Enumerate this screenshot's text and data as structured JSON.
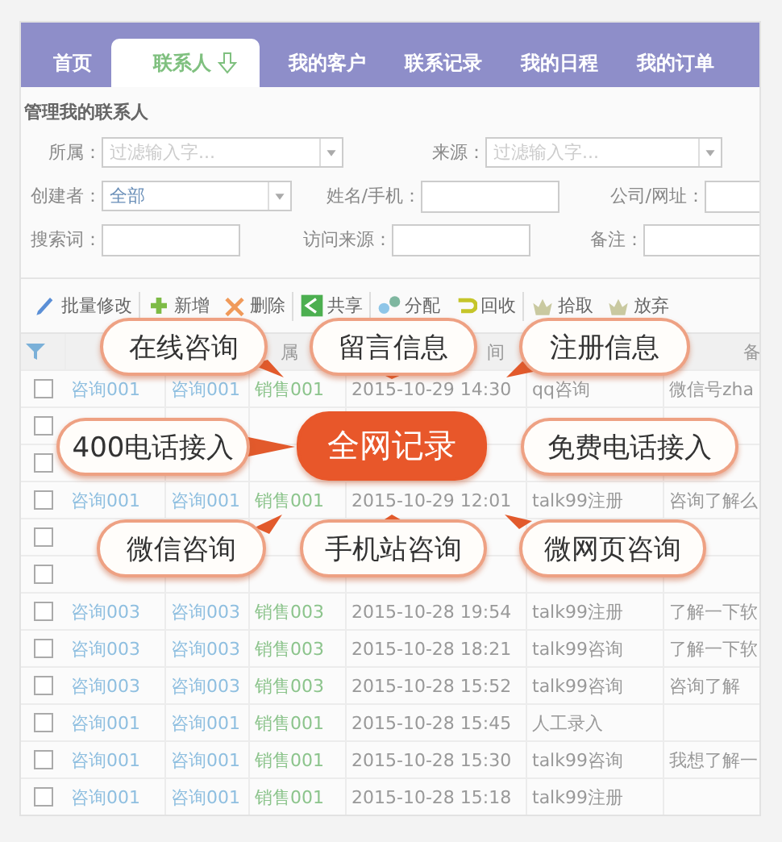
{
  "nav": {
    "tabs": [
      {
        "label": "首页",
        "selected": false
      },
      {
        "label": "联系人",
        "selected": true
      },
      {
        "label": "我的客户",
        "selected": false
      },
      {
        "label": "联系记录",
        "selected": false
      },
      {
        "label": "我的日程",
        "selected": false
      },
      {
        "label": "我的订单",
        "selected": false
      }
    ]
  },
  "heading": "管理我的联系人",
  "filters": [
    [
      {
        "label": "所属：",
        "kind": "select",
        "placeholder": "过滤输入字..."
      },
      {
        "label": "来源：",
        "kind": "select",
        "placeholder": "过滤输入字..."
      }
    ],
    [
      {
        "label": "创建者：",
        "kind": "select",
        "value": "全部"
      },
      {
        "label": "姓名/手机：",
        "kind": "input"
      },
      {
        "label": "公司/网址：",
        "kind": "input"
      }
    ],
    [
      {
        "label": "搜索词：",
        "kind": "input"
      },
      {
        "label": "访问来源：",
        "kind": "input"
      },
      {
        "label": "备注：",
        "kind": "input"
      }
    ]
  ],
  "toolbar": [
    {
      "label": "批量修改",
      "kind": "edit"
    },
    {
      "label": "新增",
      "kind": "add"
    },
    {
      "label": "删除",
      "kind": "delete"
    },
    {
      "label": "共享",
      "kind": "share"
    },
    {
      "label": "分配",
      "kind": "assign"
    },
    {
      "label": "回收",
      "kind": "recycle"
    },
    {
      "label": "拾取",
      "kind": "pick"
    },
    {
      "label": "放弃",
      "kind": "drop"
    }
  ],
  "table": {
    "columns": [
      null,
      null,
      "属",
      "间",
      null,
      "备"
    ],
    "rows": [
      {
        "checked": false,
        "cells": [
          "咨询001",
          "咨询001",
          "销售001",
          "2015-10-29 14:30",
          "qq咨询",
          "微信号zha"
        ]
      },
      {
        "checked": false,
        "cells": [
          null,
          null,
          null,
          null,
          null,
          null
        ]
      },
      {
        "checked": false,
        "cells": [
          null,
          null,
          null,
          null,
          null,
          null
        ]
      },
      {
        "checked": false,
        "cells": [
          "咨询001",
          "咨询001",
          "销售001",
          "2015-10-29 12:01",
          "talk99注册",
          "咨询了解么"
        ]
      },
      {
        "checked": false,
        "cells": [
          null,
          null,
          null,
          null,
          null,
          null
        ]
      },
      {
        "checked": false,
        "cells": [
          null,
          null,
          null,
          null,
          null,
          null
        ]
      },
      {
        "checked": false,
        "cells": [
          "咨询003",
          "咨询003",
          "销售003",
          "2015-10-28 19:54",
          "talk99注册",
          "了解一下软"
        ]
      },
      {
        "checked": false,
        "cells": [
          "咨询003",
          "咨询003",
          "销售003",
          "2015-10-28 18:21",
          "talk99咨询",
          "了解一下软"
        ]
      },
      {
        "checked": false,
        "cells": [
          "咨询003",
          "咨询003",
          "销售003",
          "2015-10-28 15:52",
          "talk99咨询",
          "咨询了解"
        ]
      },
      {
        "checked": false,
        "cells": [
          "咨询001",
          "咨询001",
          "销售001",
          "2015-10-28 15:45",
          "人工录入",
          null
        ]
      },
      {
        "checked": false,
        "cells": [
          "咨询001",
          "咨询001",
          "销售001",
          "2015-10-28 15:30",
          "talk99咨询",
          "我想了解一"
        ]
      },
      {
        "checked": false,
        "cells": [
          "咨询001",
          "咨询001",
          "销售001",
          "2015-10-28 15:18",
          "talk99注册",
          null
        ]
      }
    ]
  },
  "callouts": [
    {
      "label": "在线咨询",
      "kind": "satellite"
    },
    {
      "label": "留言信息",
      "kind": "satellite"
    },
    {
      "label": "注册信息",
      "kind": "satellite"
    },
    {
      "label": "400电话接入",
      "kind": "satellite"
    },
    {
      "label": "全网记录",
      "kind": "hub"
    },
    {
      "label": "免费电话接入",
      "kind": "satellite"
    },
    {
      "label": "微信咨询",
      "kind": "satellite"
    },
    {
      "label": "手机站咨询",
      "kind": "satellite"
    },
    {
      "label": "微网页咨询",
      "kind": "satellite"
    }
  ]
}
